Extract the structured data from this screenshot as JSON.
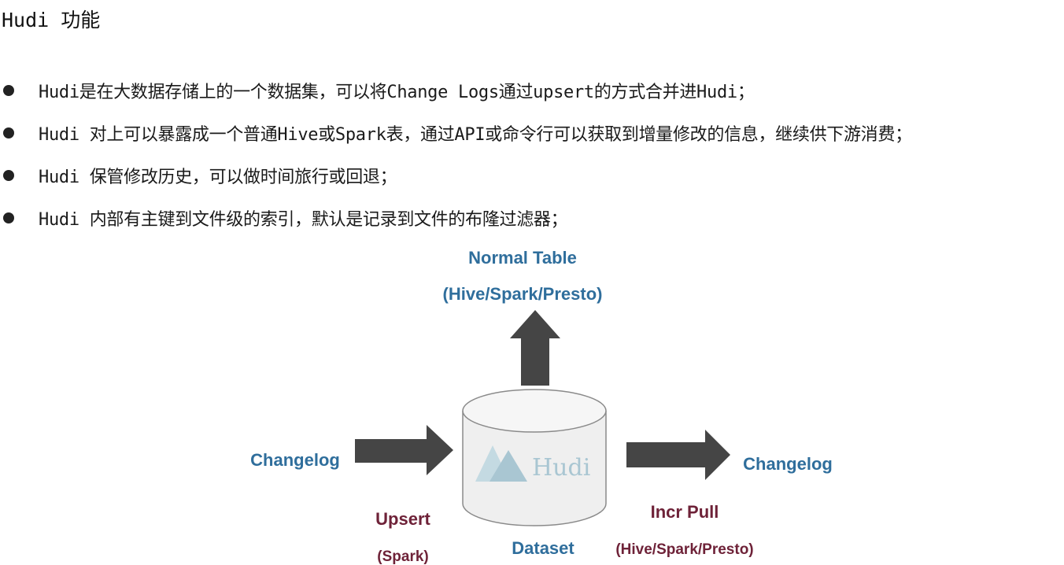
{
  "title": "Hudi 功能",
  "bullets": [
    "Hudi是在大数据存储上的一个数据集，可以将Change Logs通过upsert的方式合并进Hudi；",
    "Hudi 对上可以暴露成一个普通Hive或Spark表，通过API或命令行可以获取到增量修改的信息，继续供下游消费；",
    "Hudi 保管修改历史，可以做时间旅行或回退；",
    "Hudi 内部有主键到文件级的索引，默认是记录到文件的布隆过滤器；"
  ],
  "diagram": {
    "normal_table": "Normal Table",
    "normal_table_engines": "(Hive/Spark/Presto)",
    "changelog_in": "Changelog",
    "changelog_out": "Changelog",
    "upsert": "Upsert",
    "upsert_engine": "(Spark)",
    "dataset": "Dataset",
    "incr_pull": "Incr Pull",
    "incr_pull_engines": "(Hive/Spark/Presto)",
    "logo_text": "Hudi"
  },
  "colors": {
    "blue_label": "#2f6e9c",
    "maroon_label": "#6e2238",
    "arrow": "#454545",
    "cylinder_fill": "#efefef",
    "cylinder_stroke": "#8a8a8a",
    "logo": "#a9c6d2"
  }
}
